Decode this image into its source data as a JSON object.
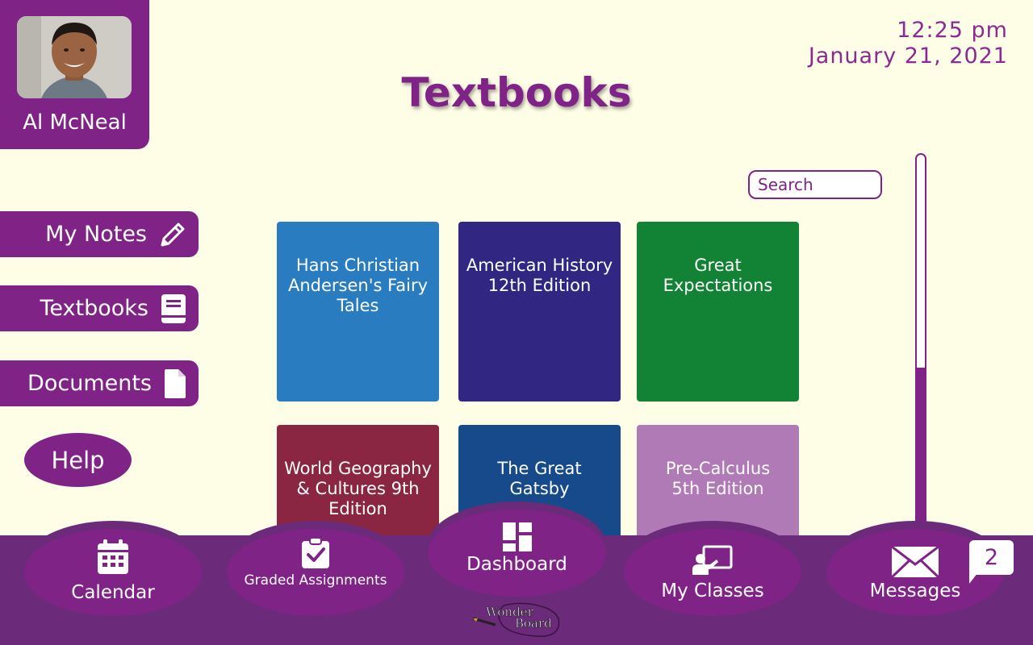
{
  "profile": {
    "name": "Al McNeal"
  },
  "clock": {
    "time": "12:25 pm",
    "date": "January 21, 2021"
  },
  "page": {
    "title": "Textbooks"
  },
  "sidebar": {
    "items": [
      {
        "label": "My Notes",
        "icon": "pencil-icon"
      },
      {
        "label": "Textbooks",
        "icon": "book-icon"
      },
      {
        "label": "Documents",
        "icon": "document-icon"
      }
    ],
    "help_label": "Help"
  },
  "search": {
    "placeholder": "Search",
    "value": ""
  },
  "books": [
    {
      "title": "Hans Christian Andersen's Fairy Tales",
      "color": "#2a7cc1"
    },
    {
      "title": "American History 12th Edition",
      "color": "#312783"
    },
    {
      "title": "Great Expectations",
      "color": "#128234"
    },
    {
      "title": "World Geography & Cultures 9th Edition",
      "color": "#8a2542"
    },
    {
      "title": "The Great Gatsby",
      "color": "#164a8a"
    },
    {
      "title": "Pre-Calculus 5th Edition",
      "color": "#b07ab6"
    }
  ],
  "dock": {
    "items": [
      {
        "label": "Calendar",
        "icon": "calendar-icon"
      },
      {
        "label": "Graded Assignments",
        "icon": "clipboard-check-icon"
      },
      {
        "label": "Dashboard",
        "icon": "dashboard-icon"
      },
      {
        "label": "My Classes",
        "icon": "classroom-icon"
      },
      {
        "label": "Messages",
        "icon": "envelope-icon"
      }
    ],
    "messages_badge": "2"
  },
  "logo": {
    "text_line1": "Wonder",
    "text_line2": "Board"
  },
  "colors": {
    "accent": "#7f2387",
    "background": "#fefde6",
    "dock": "#6b2a7a"
  }
}
